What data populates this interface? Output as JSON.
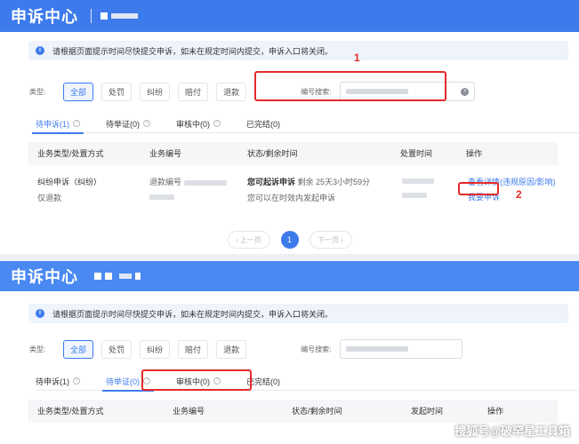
{
  "header": {
    "title": "申诉中心"
  },
  "notice": {
    "text": "请根据页面提示时间尽快提交申诉，如未在规定时间内提交，申诉入口将关闭。"
  },
  "filters": {
    "type_label": "类型:",
    "types": [
      "全部",
      "处罚",
      "纠纷",
      "赔付",
      "退款"
    ],
    "search_label": "编号搜索:"
  },
  "tabs_top": [
    {
      "label": "待申诉(1)"
    },
    {
      "label": "待举证(0)"
    },
    {
      "label": "审核中(0)"
    },
    {
      "label": "已完结(0)"
    }
  ],
  "table_top": {
    "headers": [
      "业务类型/处置方式",
      "业务编号",
      "状态/剩余时间",
      "处置时间",
      "操作"
    ],
    "row": {
      "type": "纠纷申诉（纠纷）",
      "method": "仅退款",
      "id_prefix": "退款编号",
      "status": "您可起诉申诉",
      "remaining": "剩余 25天3小时59分",
      "status_note": "您可以在时效内发起申诉",
      "action_detail": "查看详情(违规原因/影响)",
      "action_appeal": "我要申诉"
    }
  },
  "pager": {
    "prev": "上一页",
    "page": "1",
    "next": "下一页"
  },
  "tabs_bottom": [
    {
      "label": "待申诉(1)"
    },
    {
      "label": "待举证(0)"
    },
    {
      "label": "审核中(0)"
    },
    {
      "label": "已完结(0)"
    }
  ],
  "table_bottom": {
    "headers": [
      "业务类型/处置方式",
      "业务编号",
      "状态/剩余时间",
      "发起时间",
      "操作"
    ]
  },
  "annotations": {
    "a1": "1",
    "a2": "2"
  },
  "watermark": "搜狐号@破罕星工具箱",
  "colors": {
    "brand": "#3d7bec",
    "annotation": "#e52a2a"
  }
}
